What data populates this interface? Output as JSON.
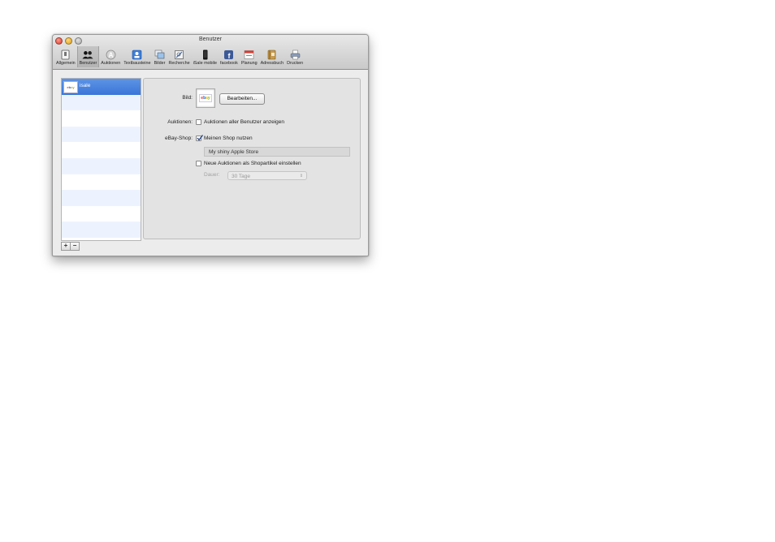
{
  "window": {
    "title": "Benutzer"
  },
  "toolbar": {
    "items": [
      {
        "label": "Allgemein",
        "icon": "general-switch-icon"
      },
      {
        "label": "Benutzer",
        "icon": "users-icon",
        "selected": true
      },
      {
        "label": "Auktionen",
        "icon": "auction-a-icon"
      },
      {
        "label": "Textbausteine",
        "icon": "text-blocks-icon"
      },
      {
        "label": "Bilder",
        "icon": "images-icon"
      },
      {
        "label": "Recherche",
        "icon": "research-icon"
      },
      {
        "label": "iSale mobile",
        "icon": "phone-icon"
      },
      {
        "label": "facebook",
        "icon": "facebook-icon"
      },
      {
        "label": "Planung",
        "icon": "calendar-icon"
      },
      {
        "label": "Adressbuch",
        "icon": "address-book-icon"
      },
      {
        "label": "Drucken",
        "icon": "printer-icon"
      }
    ]
  },
  "sidebar": {
    "users": [
      {
        "name": "isale",
        "logo_text": "ebay",
        "selected": true
      }
    ],
    "add_label": "+",
    "remove_label": "−"
  },
  "form": {
    "image_label": "Bild:",
    "image_logo_text": "ebay",
    "edit_button": "Bearbeiten...",
    "auctions_label": "Auktionen:",
    "auctions_checkbox": "Auktionen aller Benutzer anzeigen",
    "auctions_checked": false,
    "shop_label": "eBay-Shop:",
    "shop_checkbox": "Meinen Shop nutzen",
    "shop_checked": true,
    "shop_name": "My shiny Apple Store",
    "shop_items_checkbox": "Neue Auktionen als Shopartikel einstellen",
    "shop_items_checked": false,
    "duration_label": "Dauer:",
    "duration_value": "30 Tage"
  },
  "colors": {
    "selection": "#3a76d8",
    "ebay_red": "#e53238",
    "ebay_blue": "#0064d2",
    "ebay_yellow": "#f5af02",
    "ebay_green": "#86b817"
  }
}
